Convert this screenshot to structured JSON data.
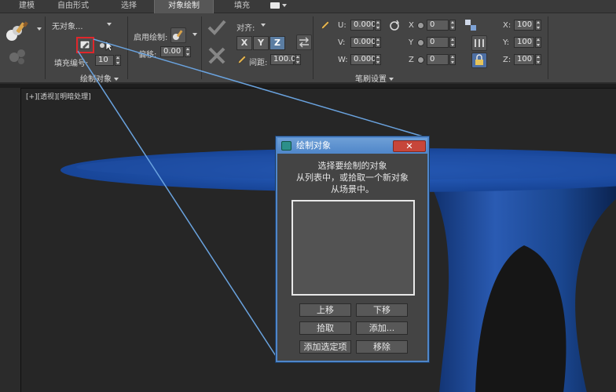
{
  "tabs": [
    {
      "label": "建模"
    },
    {
      "label": "自由形式"
    },
    {
      "label": "选择"
    },
    {
      "label": "对象绘制",
      "active": true
    },
    {
      "label": "填充"
    }
  ],
  "paint_objects_panel": {
    "object_dropdown": "无对象...",
    "fill_number_label": "填充编号:",
    "fill_number_value": "10",
    "footer_label": "绘制对象"
  },
  "brush_panel": {
    "enable_paint_label": "启用绘制:",
    "offset_label": "偏移:",
    "offset_value": "0.00",
    "align_label": "对齐:",
    "axis_x": "X",
    "axis_y": "Y",
    "axis_z": "Z",
    "spacing_label": "间距:",
    "spacing_value": "100.0",
    "u_label": "U:",
    "u_value": "0.000",
    "v_label": "V:",
    "v_value": "0.000",
    "w_label": "W:",
    "w_value": "0.000",
    "rx_label": "X",
    "rx_value": "0",
    "ry_label": "Y",
    "ry_value": "0",
    "rz_label": "Z",
    "rz_value": "0",
    "sx_label": "X:",
    "sx_value": "100",
    "sy_label": "Y:",
    "sy_value": "100",
    "sz_label": "Z:",
    "sz_value": "100",
    "footer_label": "笔刷设置"
  },
  "viewport": {
    "label": "[+][透视][明暗处理]"
  },
  "dialog": {
    "title": "绘制对象",
    "close_label": "✕",
    "message_line1": "选择要绘制的对象",
    "message_line2": "从列表中，或拾取一个新对象",
    "message_line3": "从场景中。",
    "btn_move_up": "上移",
    "btn_move_down": "下移",
    "btn_pick": "拾取",
    "btn_add": "添加...",
    "btn_add_selected": "添加选定项",
    "btn_remove": "移除"
  },
  "colors": {
    "object_blue": "#1f4fa3",
    "highlight_red": "#e0262b",
    "callout_blue": "#6aa3df"
  }
}
